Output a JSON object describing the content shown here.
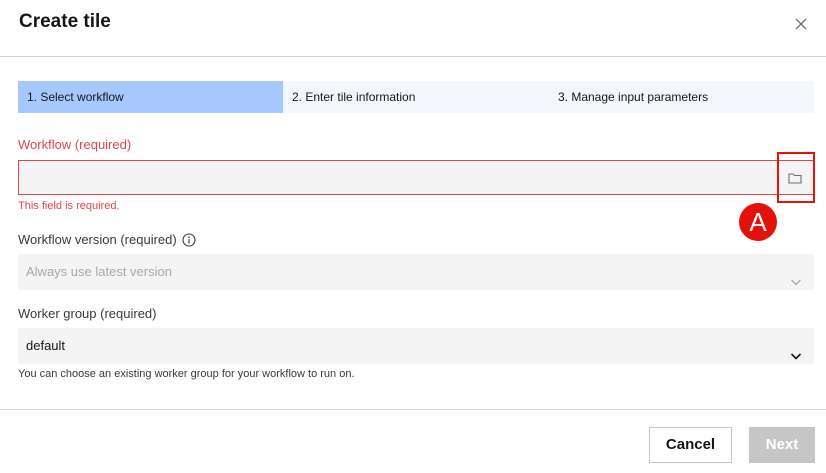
{
  "dialog": {
    "title": "Create tile"
  },
  "steps": [
    {
      "label": "1. Select workflow",
      "active": true
    },
    {
      "label": "2. Enter tile information",
      "active": false
    },
    {
      "label": "3. Manage input parameters",
      "active": false
    }
  ],
  "workflow": {
    "label": "Workflow (required)",
    "value": "",
    "error": "This field is required.",
    "browse_icon": "folder-icon"
  },
  "version": {
    "label": "Workflow version (required)",
    "placeholder": "Always use latest version",
    "info_icon": "info-icon"
  },
  "worker_group": {
    "label": "Worker group (required)",
    "value": "default",
    "helper": "You can choose an existing worker group for your workflow to run on."
  },
  "footer": {
    "cancel_label": "Cancel",
    "next_label": "Next"
  },
  "annotation": {
    "marker": "A"
  },
  "colors": {
    "active_step": "#a6c8ff",
    "error": "#e0454b",
    "annotation": "#e3120b"
  }
}
